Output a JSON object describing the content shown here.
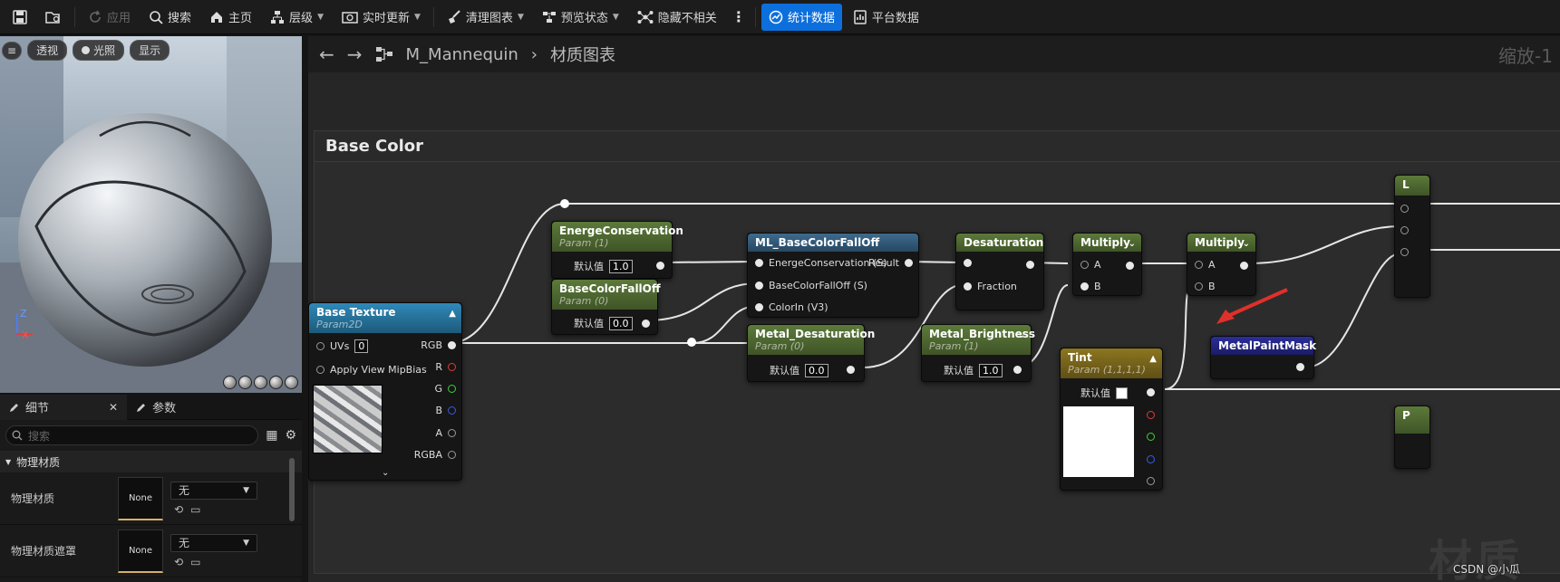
{
  "toolbar": {
    "apply": "应用",
    "search": "搜索",
    "home": "主页",
    "hierarchy": "层级",
    "live_update": "实时更新",
    "clean_graph": "清理图表",
    "preview_state": "预览状态",
    "hide_unrelated": "隐藏不相关",
    "stats": "统计数据",
    "platform_stats": "平台数据"
  },
  "viewport": {
    "perspective": "透视",
    "lighting": "光照",
    "show": "显示",
    "axis_z": "Z",
    "axis_x": "X"
  },
  "details": {
    "tab_details": "细节",
    "tab_params": "参数",
    "search_placeholder": "搜索",
    "category": "物理材质",
    "rows": [
      {
        "label": "物理材质",
        "thumb": "None",
        "value": "无"
      },
      {
        "label": "物理材质遮罩",
        "thumb": "None",
        "value": "无"
      }
    ]
  },
  "graph": {
    "asset": "M_Mannequin",
    "crumb": "材质图表",
    "zoom": "缩放-1",
    "comment_title": "Base Color",
    "watermark": "材质",
    "credit": "CSDN @小瓜"
  },
  "nodes": {
    "base_texture": {
      "title": "Base Texture",
      "sub": "Param2D",
      "uvs": "UVs",
      "uvs_val": "0",
      "mip": "Apply View MipBias",
      "rgb": "RGB",
      "r": "R",
      "g": "G",
      "b": "B",
      "a": "A",
      "rgba": "RGBA"
    },
    "energe": {
      "title": "EnergeConservation",
      "sub": "Param (1)",
      "label": "默认值",
      "value": "1.0"
    },
    "bcfo": {
      "title": "BaseColorFallOff",
      "sub": "Param (0)",
      "label": "默认值",
      "value": "0.0"
    },
    "ml": {
      "title": "ML_BaseColorFallOff",
      "in1": "EnergeConservation (S)",
      "in2": "BaseColorFallOff (S)",
      "in3": "ColorIn (V3)",
      "out": "Result"
    },
    "metal_desat": {
      "title": "Metal_Desaturation",
      "sub": "Param (0)",
      "label": "默认值",
      "value": "0.0"
    },
    "desat": {
      "title": "Desaturation",
      "fraction": "Fraction"
    },
    "metal_bright": {
      "title": "Metal_Brightness",
      "sub": "Param (1)",
      "label": "默认值",
      "value": "1.0"
    },
    "mult1": {
      "title": "Multiply",
      "a": "A",
      "b": "B"
    },
    "mult2": {
      "title": "Multiply",
      "a": "A",
      "b": "B"
    },
    "tint": {
      "title": "Tint",
      "sub": "Param (1,1,1,1)",
      "label": "默认值"
    },
    "mpm": {
      "title": "MetalPaintMask"
    },
    "edge1": {
      "title": "L"
    },
    "edge2": {
      "title": "P"
    }
  }
}
